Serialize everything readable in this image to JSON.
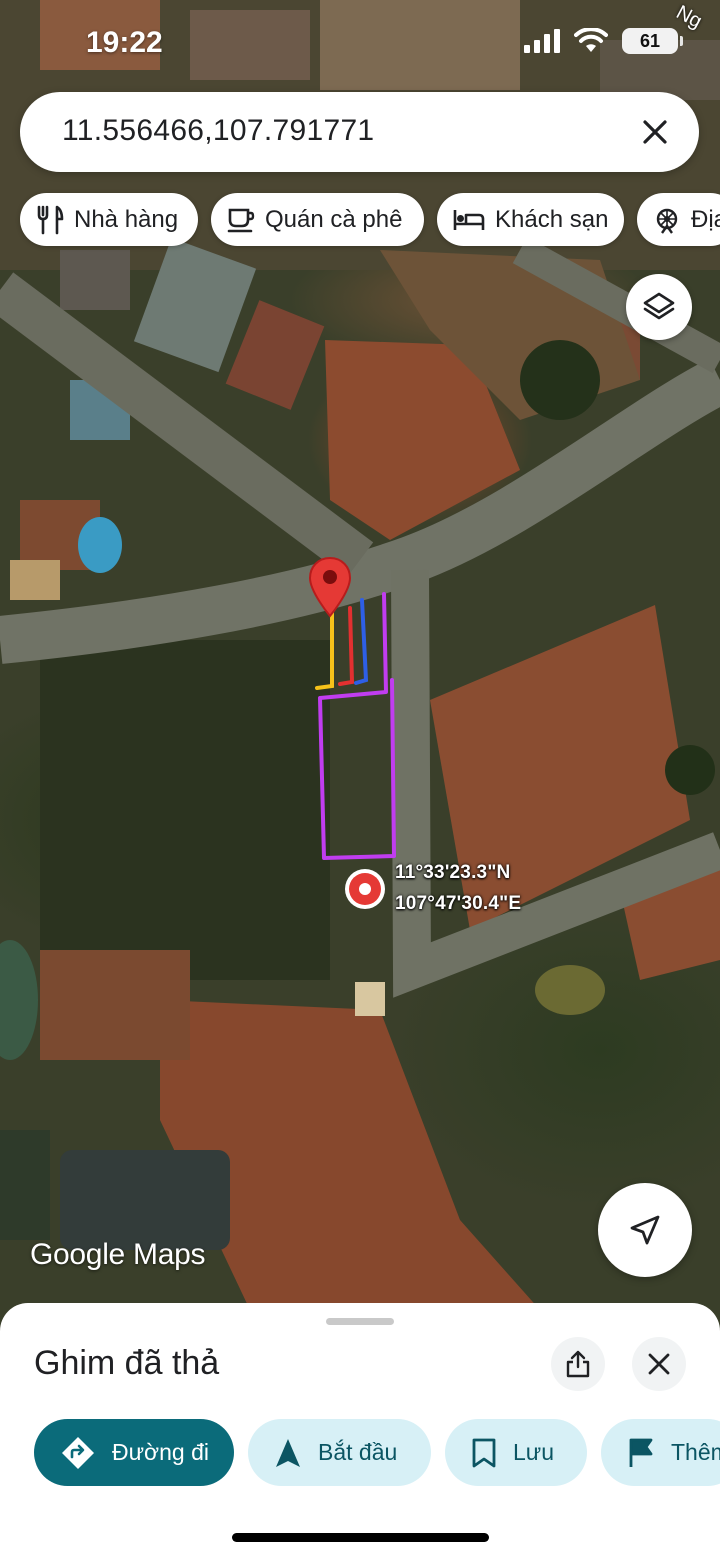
{
  "status_bar": {
    "time": "19:22",
    "battery": "61"
  },
  "search": {
    "query": "11.556466,107.791771"
  },
  "chips": [
    {
      "label": "Nhà hàng",
      "icon": "restaurant-icon"
    },
    {
      "label": "Quán cà phê",
      "icon": "coffee-icon"
    },
    {
      "label": "Khách sạn",
      "icon": "hotel-icon"
    },
    {
      "label": "Địa",
      "icon": "attraction-icon"
    }
  ],
  "map": {
    "coordinates": {
      "lat": "11°33'23.3\"N",
      "lng": "107°47'30.4\"E"
    },
    "watermark_google": "Google",
    "watermark_maps": "Maps",
    "corner_text": "Ng"
  },
  "sheet": {
    "title": "Ghim đã thả",
    "actions": [
      {
        "label": "Đường đi",
        "icon": "directions-icon"
      },
      {
        "label": "Bắt đầu",
        "icon": "navigation-arrow-icon"
      },
      {
        "label": "Lưu",
        "icon": "bookmark-icon"
      },
      {
        "label": "Thêm",
        "icon": "flag-icon"
      }
    ]
  },
  "colors": {
    "primary_action": "#0b6b7a",
    "secondary_action": "#d7f0f6",
    "pin_red": "#e53935",
    "plot_outline": "#c13df0"
  }
}
